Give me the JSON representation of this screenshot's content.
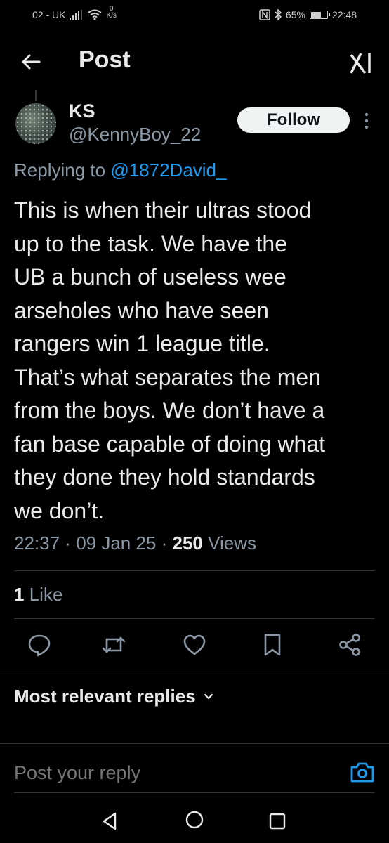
{
  "status_bar": {
    "carrier": "02 - UK",
    "net_speed_value": "0",
    "net_speed_unit": "K/s",
    "battery_percent": "65%",
    "battery_level": 0.65,
    "time": "22:48"
  },
  "header": {
    "title": "Post",
    "back_icon": "arrow-left-icon",
    "grok_icon": "grok-icon"
  },
  "post": {
    "author_name": "KS",
    "author_handle": "@KennyBoy_22",
    "follow_label": "Follow",
    "replying_prefix": "Replying to",
    "replying_to": "@1872David_",
    "text": "This is when their ultras stood\nup to the task. We have the\nUB a bunch of useless wee\narseholes who have seen\nrangers win 1 league title.\nThat’s what separates the men\nfrom the boys. We don’t have a\nfan base capable of doing what\nthey done they hold standards\nwe don’t.",
    "time": "22:37",
    "date": "09 Jan 25",
    "views_count": "250",
    "views_label": "Views",
    "likes_count": "1",
    "likes_label": "Like"
  },
  "actions": [
    "reply-icon",
    "repost-icon",
    "like-icon",
    "bookmark-icon",
    "share-icon"
  ],
  "replies": {
    "sort_label": "Most relevant replies"
  },
  "composer": {
    "placeholder": "Post your reply"
  },
  "colors": {
    "background": "#000000",
    "text": "#e7e9ea",
    "secondary_text": "#8b98a5",
    "link": "#1d9bf0",
    "divider": "#2f3336"
  }
}
